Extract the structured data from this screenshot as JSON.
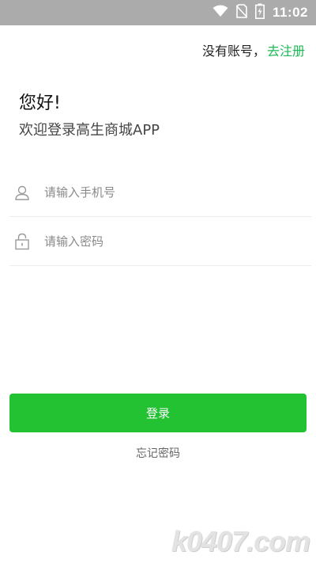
{
  "status_bar": {
    "time": "11:02",
    "icons": [
      "wifi-icon",
      "no-sim-icon",
      "battery-charging-icon"
    ]
  },
  "header": {
    "prompt": "没有账号，",
    "register_link": "去注册"
  },
  "welcome": {
    "greeting": "您好!",
    "subtitle": "欢迎登录高生商城APP"
  },
  "form": {
    "phone": {
      "value": "",
      "placeholder": "请输入手机号",
      "icon": "user-icon"
    },
    "password": {
      "value": "",
      "placeholder": "请输入密码",
      "icon": "lock-icon"
    },
    "login_label": "登录",
    "forgot_label": "忘记密码"
  },
  "watermark": "k0407.com",
  "colors": {
    "accent": "#22c232",
    "link": "#1db954",
    "status_bar": "#ababab"
  }
}
